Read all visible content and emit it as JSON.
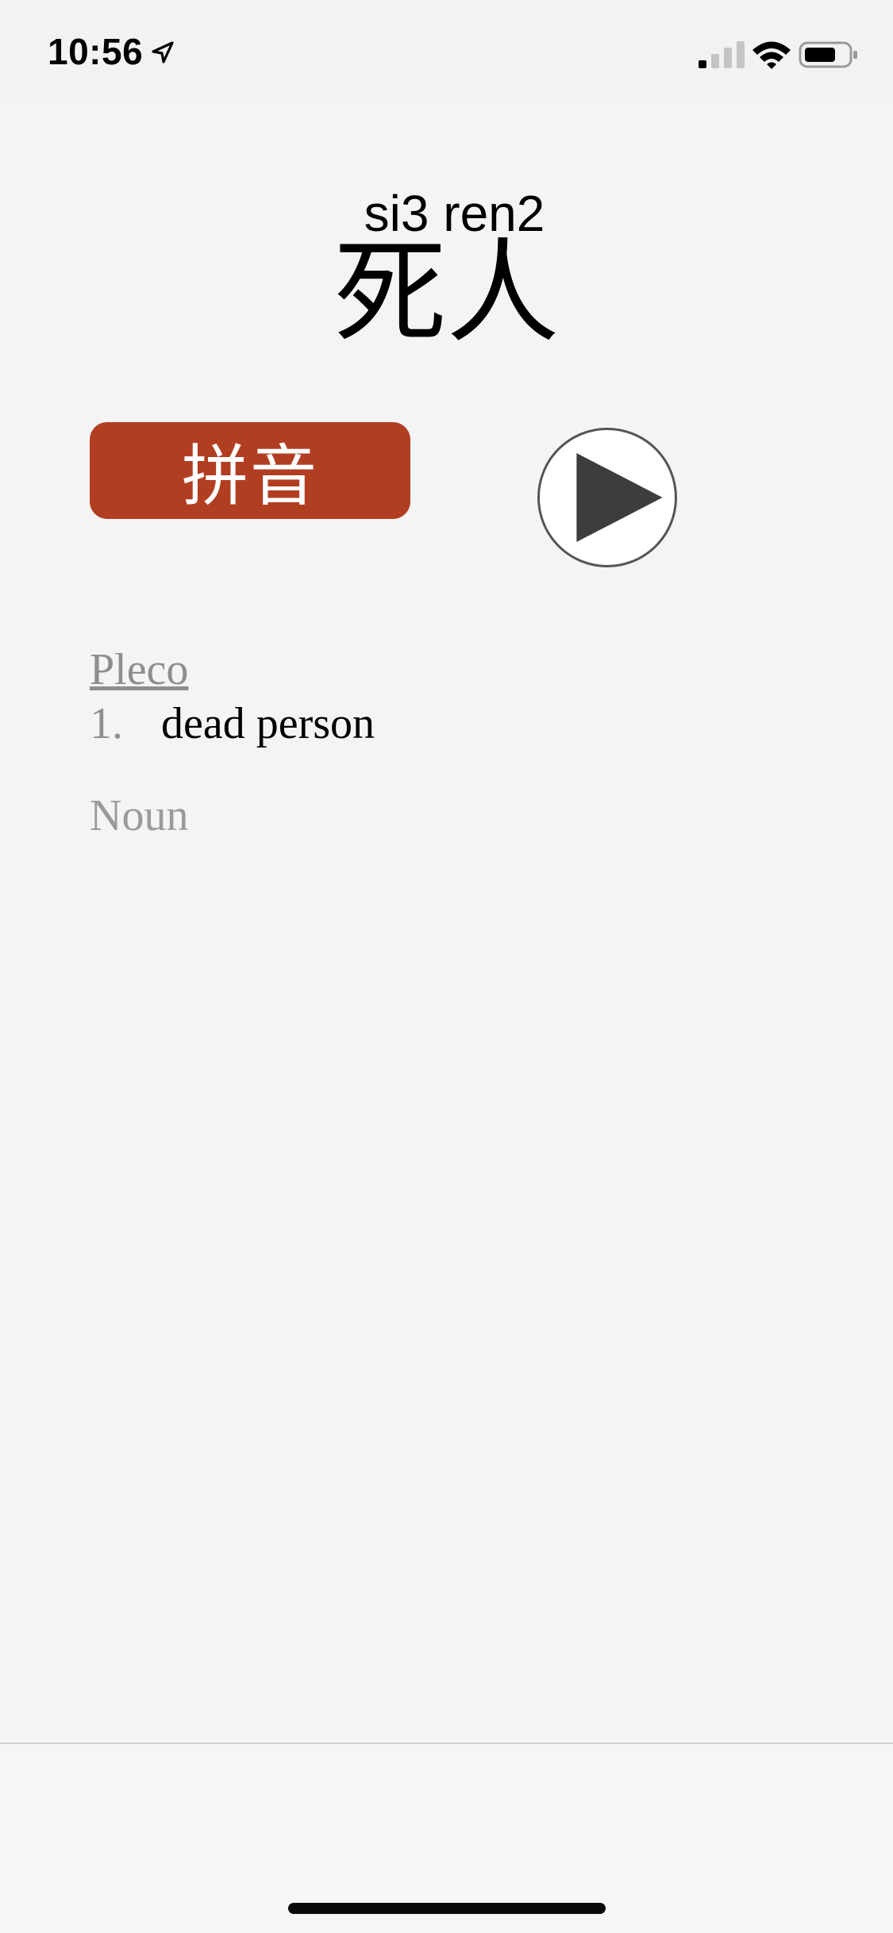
{
  "status_bar": {
    "time": "10:56",
    "location_icon": "location-arrow-icon",
    "signal_icon": "cellular-signal-icon",
    "wifi_icon": "wifi-icon",
    "battery_icon": "battery-icon"
  },
  "entry": {
    "pinyin": "si3 ren2",
    "hanzi": "死人"
  },
  "actions": {
    "pinyin_button_label": "拼音",
    "pinyin_button_color": "#b23e22",
    "play_icon": "play-icon"
  },
  "definitions": {
    "source": "Pleco",
    "items": [
      {
        "number": "1.",
        "text": "dead person"
      }
    ],
    "part_of_speech": "Noun"
  },
  "toolbar": {
    "settings_icon": "gear-icon",
    "accent_color": "#2b63c9"
  }
}
